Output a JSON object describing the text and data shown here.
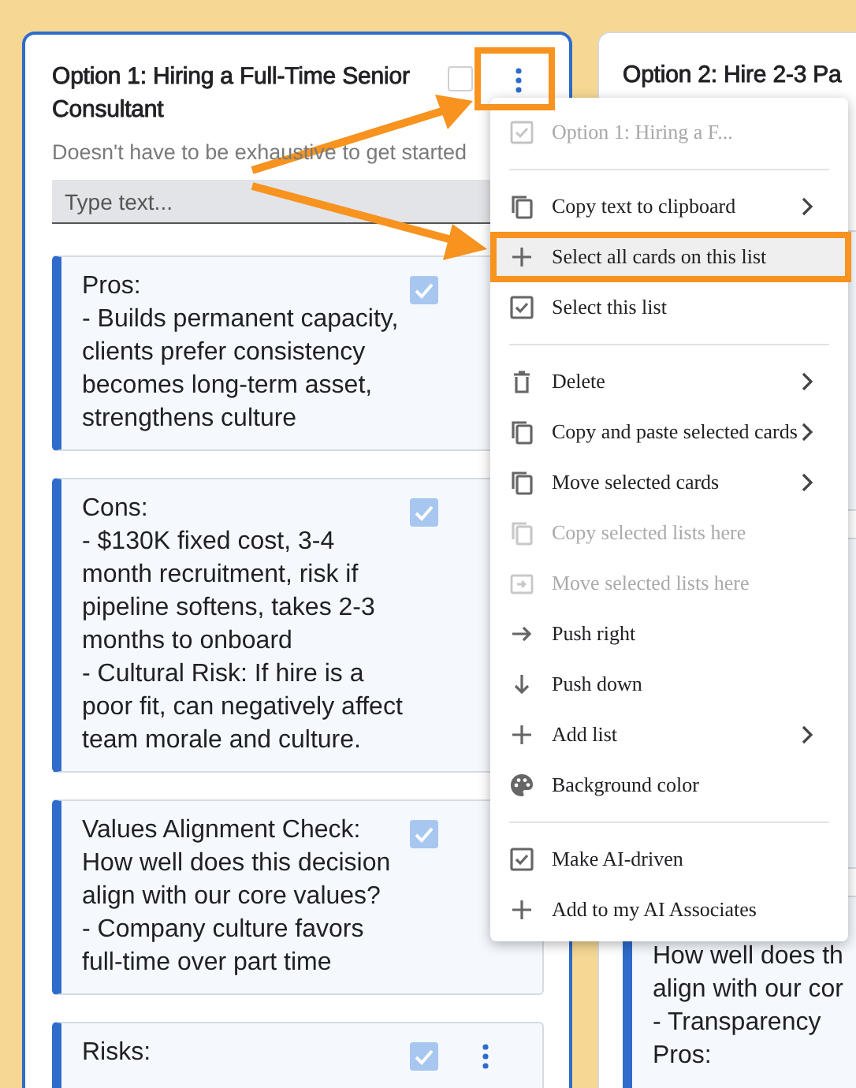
{
  "columns": [
    {
      "title": "Option 1: Hiring a Full-Time Senior Consultant",
      "checked": false,
      "subtitle": "Doesn't have to be exhaustive to get started",
      "input": {
        "placeholder": "Type text..."
      },
      "cards": [
        {
          "kind": "text",
          "text": "Pros:\n- Builds permanent capacity, clients prefer consistency becomes long-term asset, strengthens culture",
          "checked": true,
          "has_menu_button": false
        },
        {
          "kind": "text",
          "text": "Cons:\n- $130K fixed cost, 3-4 month recruitment, risk if pipeline softens, takes 2-3 months to onboard\n- Cultural Risk: If hire is a poor fit, can negatively affect team morale and culture.",
          "checked": true,
          "has_menu_button": false
        },
        {
          "kind": "text",
          "text": "Values Alignment Check: How well does this decision align with our core values?\n- Company culture favors full-time over part time",
          "checked": true,
          "has_menu_button": false
        },
        {
          "kind": "text",
          "text": "Risks:",
          "checked": true,
          "has_menu_button": true
        }
      ]
    },
    {
      "title": "Option 2: Hire 2-3 Pa",
      "cards": [
        {
          "kind": "covered"
        },
        {
          "kind": "covered"
        },
        {
          "kind": "text",
          "text": "How well does th\nalign with our cor\n- Transparency\nPros:"
        }
      ]
    }
  ],
  "menu": {
    "header": "Option 1: Hiring a F...",
    "items": [
      {
        "kind": "item",
        "label": "Copy text to clipboard",
        "submenu": true,
        "disabled": false,
        "highlighted": false
      },
      {
        "kind": "item",
        "label": "Select all cards on this list",
        "submenu": false,
        "disabled": false,
        "highlighted": true
      },
      {
        "kind": "item",
        "label": "Select this list",
        "submenu": false,
        "disabled": false,
        "highlighted": false
      },
      {
        "kind": "divider"
      },
      {
        "kind": "item",
        "label": "Delete",
        "submenu": true,
        "disabled": false,
        "highlighted": false
      },
      {
        "kind": "item",
        "label": "Copy and paste selected cards",
        "submenu": true,
        "disabled": false,
        "highlighted": false
      },
      {
        "kind": "item",
        "label": "Move selected cards",
        "submenu": true,
        "disabled": false,
        "highlighted": false
      },
      {
        "kind": "item",
        "label": "Copy selected lists here",
        "submenu": false,
        "disabled": true,
        "highlighted": false
      },
      {
        "kind": "item",
        "label": "Move selected lists here",
        "submenu": false,
        "disabled": true,
        "highlighted": false
      },
      {
        "kind": "item",
        "label": "Push right",
        "submenu": false,
        "disabled": false,
        "highlighted": false
      },
      {
        "kind": "item",
        "label": "Push down",
        "submenu": false,
        "disabled": false,
        "highlighted": false
      },
      {
        "kind": "item",
        "label": "Add list",
        "submenu": true,
        "disabled": false,
        "highlighted": false
      },
      {
        "kind": "item",
        "label": "Background color",
        "submenu": false,
        "disabled": false,
        "highlighted": false
      },
      {
        "kind": "divider"
      },
      {
        "kind": "item",
        "label": "Make AI-driven",
        "submenu": false,
        "disabled": false,
        "highlighted": false
      },
      {
        "kind": "item",
        "label": "Add to my AI Associates",
        "submenu": false,
        "disabled": false,
        "highlighted": false
      }
    ]
  }
}
